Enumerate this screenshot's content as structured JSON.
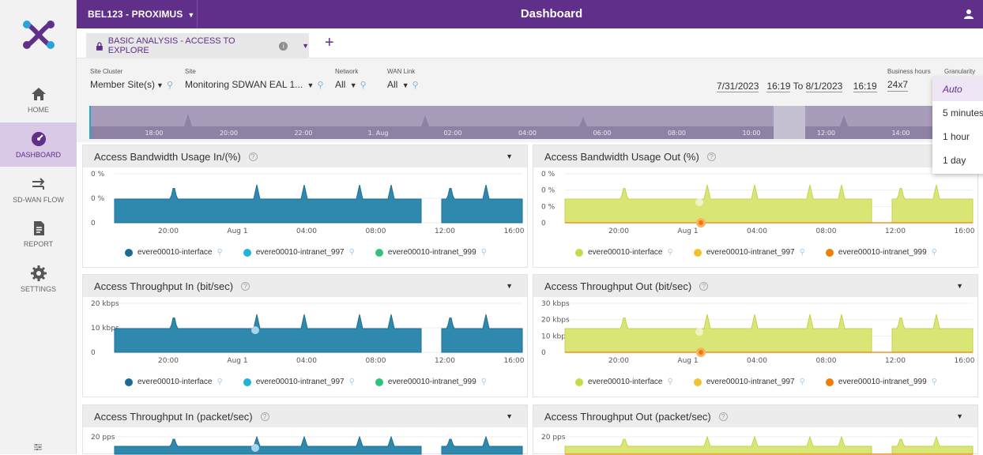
{
  "header": {
    "tenant": "BEL123 - PROXIMUS",
    "title": "Dashboard"
  },
  "nav": [
    {
      "label": "HOME",
      "icon": "home-icon"
    },
    {
      "label": "DASHBOARD",
      "icon": "dashboard-icon"
    },
    {
      "label": "SD-WAN FLOW",
      "icon": "flow-icon"
    },
    {
      "label": "REPORT",
      "icon": "report-icon"
    },
    {
      "label": "SETTINGS",
      "icon": "gear-icon"
    }
  ],
  "tab": {
    "label": "BASIC ANALYSIS - ACCESS TO EXPLORE"
  },
  "filters": {
    "site_cluster": {
      "caption": "Site Cluster",
      "value": "Member Site(s)"
    },
    "site": {
      "caption": "Site",
      "value": "Monitoring SDWAN EAL 1..."
    },
    "network": {
      "caption": "Network",
      "value": "All"
    },
    "wan_link": {
      "caption": "WAN Link",
      "value": "All"
    },
    "business_hours": {
      "caption": "Business hours",
      "value": "24x7"
    },
    "granularity": {
      "caption": "Granularity"
    },
    "date_from": "7/31/2023",
    "time_from": "16:19",
    "to_label": "To",
    "date_to": "8/1/2023",
    "time_to": "16:19"
  },
  "timeline": {
    "ticks": [
      "18:00",
      "20:00",
      "22:00",
      "1. Aug",
      "02:00",
      "04:00",
      "06:00",
      "08:00",
      "10:00",
      "12:00",
      "14:00"
    ]
  },
  "granularity_options": [
    "Auto",
    "5 minutes",
    "1 hour",
    "1 day"
  ],
  "granularity_selected": "Auto",
  "colors": {
    "brand": "#5f2f8a",
    "blue_series": "#2f88ad",
    "yellow_series": "#d6e26c",
    "orange_series": "#f07d00"
  },
  "x_ticks": [
    "20:00",
    "Aug 1",
    "04:00",
    "08:00",
    "12:00",
    "16:00"
  ],
  "panels": [
    {
      "title": "Access Bandwidth Usage In/(%)",
      "yticks": [
        "0 %",
        "0 %",
        "0"
      ],
      "palette": "blue",
      "legend": [
        "evere00010-interface",
        "evere00010-intranet_997",
        "evere00010-intranet_999"
      ]
    },
    {
      "title": "Access Bandwidth Usage Out (%)",
      "yticks": [
        "0 %",
        "0 %",
        "0 %",
        "0"
      ],
      "palette": "yellow",
      "legend": [
        "evere00010-interface",
        "evere00010-intranet_997",
        "evere00010-intranet_999"
      ]
    },
    {
      "title": "Access Throughput In (bit/sec)",
      "yticks": [
        "20 kbps",
        "10 kbps",
        "0"
      ],
      "palette": "blue",
      "legend": [
        "evere00010-interface",
        "evere00010-intranet_997",
        "evere00010-intranet_999"
      ]
    },
    {
      "title": "Access Throughput Out (bit/sec)",
      "yticks": [
        "30 kbps",
        "20 kbps",
        "10 kbps",
        "0"
      ],
      "palette": "yellow",
      "legend": [
        "evere00010-interface",
        "evere00010-intranet_997",
        "evere00010-intranet_999"
      ]
    },
    {
      "title": "Access Throughput In (packet/sec)",
      "yticks": [
        "20 pps"
      ],
      "palette": "blue",
      "legend": []
    },
    {
      "title": "Access Throughput Out (packet/sec)",
      "yticks": [
        "20 pps"
      ],
      "palette": "yellow",
      "legend": []
    }
  ]
}
